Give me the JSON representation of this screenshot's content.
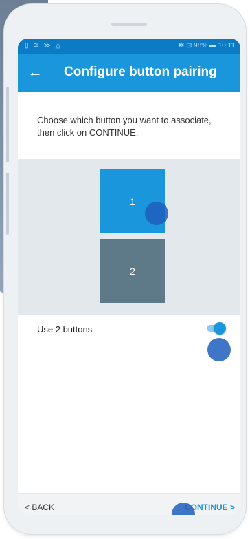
{
  "statusbar": {
    "left_icons": "▯ ≋ ≫ △",
    "right_text": "✻ ⊡ 98% ▬ 10:11"
  },
  "appbar": {
    "back_icon": "←",
    "title": "Configure button pairing"
  },
  "instruction": "Choose which button you want to associate, then click on CONTINUE.",
  "buttons": [
    {
      "label": "1",
      "color": "#1a96dc",
      "selected": true
    },
    {
      "label": "2",
      "color": "#5e7987",
      "selected": false
    }
  ],
  "use_two_buttons": {
    "label": "Use 2 buttons",
    "enabled": true
  },
  "footer": {
    "back_label": "< BACK",
    "continue_label": "CONTINUE >"
  },
  "colors": {
    "primary": "#1a96dc",
    "statusbar": "#0a7bc4",
    "pairing_area": "#e3e8ec",
    "touch_indicator": "#1f5ebd"
  },
  "icons": {
    "back": "arrow-left-icon",
    "bluetooth": "bluetooth-icon",
    "battery": "battery-icon"
  }
}
